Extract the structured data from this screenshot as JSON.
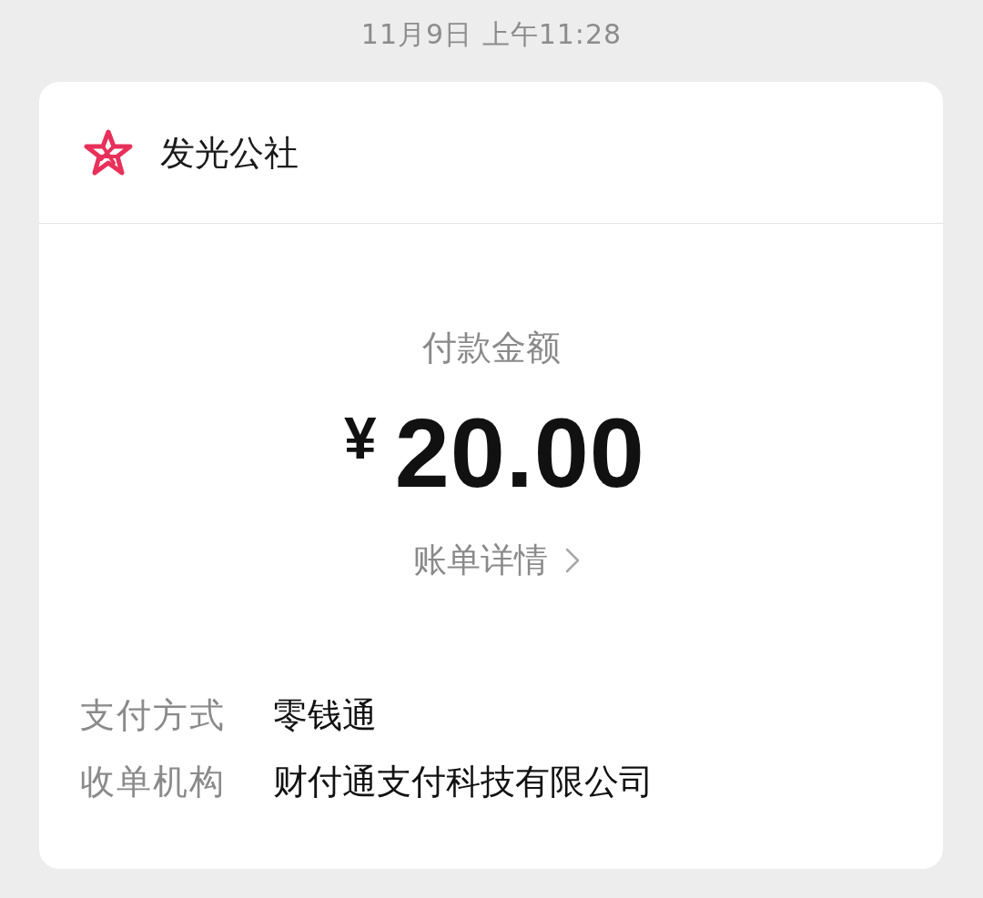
{
  "timestamp": "11月9日 上午11:28",
  "merchant": {
    "name": "发光公社"
  },
  "payment": {
    "label": "付款金额",
    "currency": "¥",
    "amount": "20.00"
  },
  "details_link": {
    "label": "账单详情"
  },
  "info_rows": [
    {
      "label": "支付方式",
      "value": "零钱通"
    },
    {
      "label": "收单机构",
      "value": "财付通支付科技有限公司"
    }
  ]
}
